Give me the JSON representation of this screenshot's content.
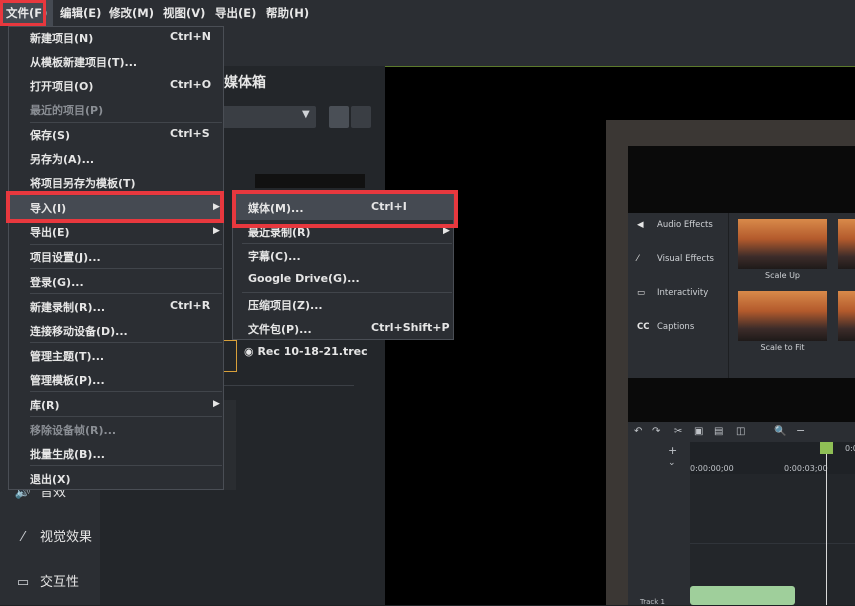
{
  "menubar": {
    "items": [
      "文件(F)",
      "编辑(E)",
      "修改(M)",
      "视图(V)",
      "导出(E)",
      "帮助(H)"
    ]
  },
  "media_bin": {
    "title": "媒体箱",
    "recording_label": "Rec 10-18-21.trec"
  },
  "left_panel": {
    "items": [
      {
        "label": "音效",
        "icon": "audio-icon"
      },
      {
        "label": "视觉效果",
        "icon": "magic-wand-icon"
      },
      {
        "label": "交互性",
        "icon": "interactivity-icon"
      }
    ]
  },
  "file_menu": {
    "items": [
      {
        "label": "新建项目(N)",
        "shortcut": "Ctrl+N"
      },
      {
        "label": "从模板新建项目(T)...",
        "shortcut": ""
      },
      {
        "label": "打开项目(O)",
        "shortcut": "Ctrl+O"
      },
      {
        "label": "最近的项目(P)",
        "shortcut": "",
        "disabled": true
      },
      {
        "label": "保存(S)",
        "shortcut": "Ctrl+S"
      },
      {
        "label": "另存为(A)...",
        "shortcut": ""
      },
      {
        "label": "将项目另存为模板(T)",
        "shortcut": ""
      },
      {
        "label": "导入(I)",
        "shortcut": "",
        "submenu": true,
        "active": true
      },
      {
        "label": "导出(E)",
        "shortcut": "",
        "submenu": true
      },
      {
        "label": "项目设置(J)...",
        "shortcut": ""
      },
      {
        "label": "登录(G)...",
        "shortcut": ""
      },
      {
        "label": "新建录制(R)...",
        "shortcut": "Ctrl+R"
      },
      {
        "label": "连接移动设备(D)...",
        "shortcut": ""
      },
      {
        "label": "管理主题(T)...",
        "shortcut": ""
      },
      {
        "label": "管理模板(P)...",
        "shortcut": ""
      },
      {
        "label": "库(R)",
        "shortcut": "",
        "submenu": true
      },
      {
        "label": "移除设备帧(R)...",
        "shortcut": "",
        "disabled": true
      },
      {
        "label": "批量生成(B)...",
        "shortcut": ""
      },
      {
        "label": "退出(X)",
        "shortcut": ""
      }
    ]
  },
  "import_submenu": {
    "items": [
      {
        "label": "媒体(M)...",
        "shortcut": "Ctrl+I",
        "active": true
      },
      {
        "label": "最近录制(R)",
        "shortcut": "",
        "submenu": true
      },
      {
        "label": "字幕(C)...",
        "shortcut": ""
      },
      {
        "label": "Google Drive(G)...",
        "shortcut": ""
      },
      {
        "label": "压缩项目(Z)...",
        "shortcut": ""
      },
      {
        "label": "文件包(P)...",
        "shortcut": "Ctrl+Shift+P"
      }
    ]
  },
  "preview": {
    "effects": [
      {
        "label": "Audio Effects",
        "icon": "speaker-icon"
      },
      {
        "label": "Visual Effects",
        "icon": "magic-wand-icon"
      },
      {
        "label": "Interactivity",
        "icon": "interactivity-icon"
      },
      {
        "label": "Captions",
        "icon": "cc-icon"
      }
    ],
    "thumbnails": [
      "Scale Up",
      "Scale to Fit"
    ],
    "timecodes": [
      "0:00:00;00",
      "0:00:03;00",
      "0:0"
    ],
    "track_label": "Track 1"
  },
  "colors": {
    "highlight_red": "#e8383e",
    "menu_bg": "#2b2e33",
    "active_item_bg": "#454a52",
    "playhead_green": "#8fbf55"
  }
}
